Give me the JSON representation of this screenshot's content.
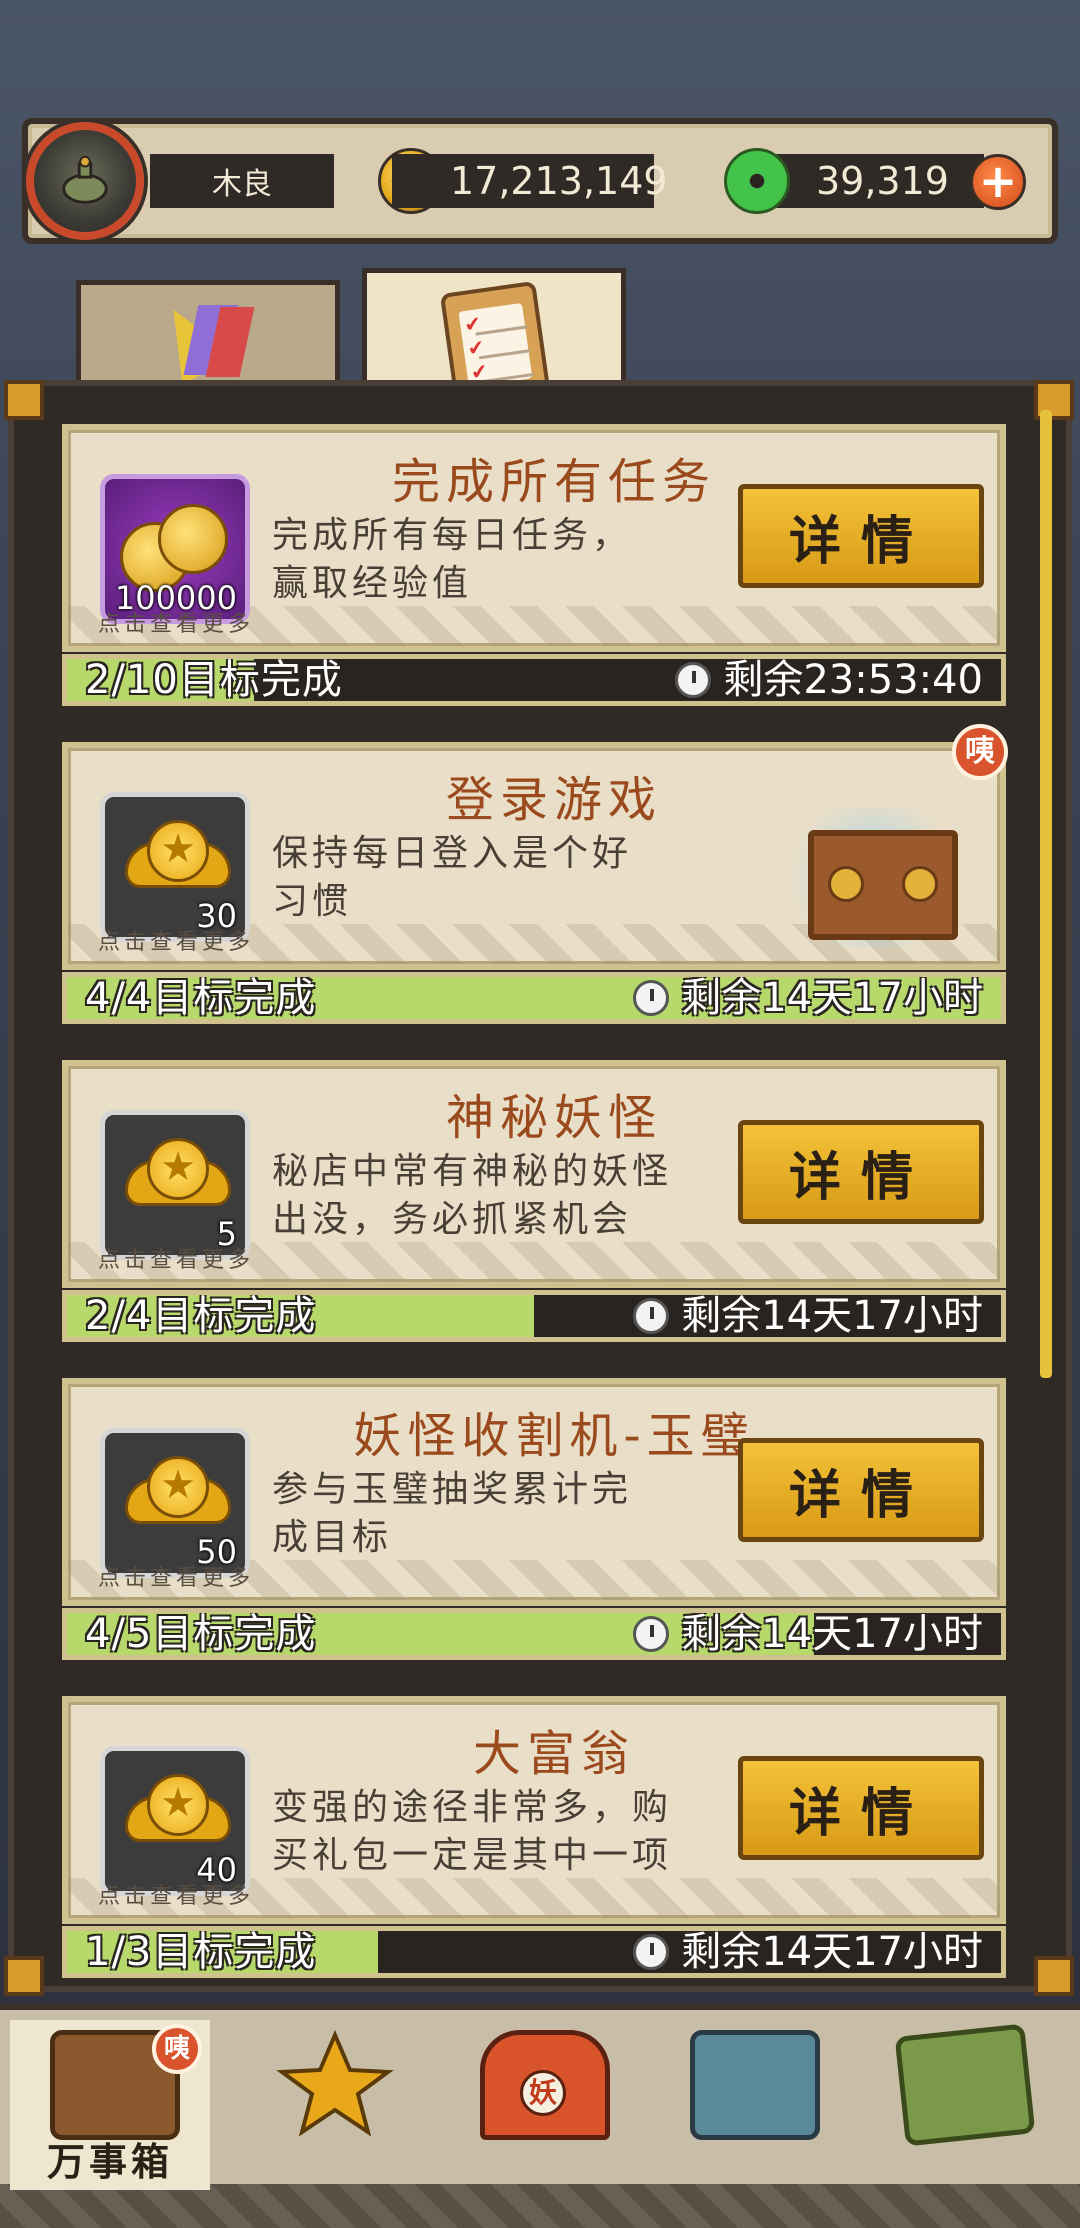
{
  "header": {
    "player_name": "木良",
    "coins": "17,213,149",
    "jade": "39,319",
    "plus_symbol": "+"
  },
  "tabs": [
    {
      "name": "flags",
      "active": false
    },
    {
      "name": "tasks",
      "active": true
    }
  ],
  "tasks": [
    {
      "title": "完成所有任务",
      "description": "完成所有每日任务，赢取经验值",
      "desc_line1": "完成所有每日任务，",
      "desc_line2": "赢取经验值",
      "reward_count": "100000",
      "reward_icon": "gold-coins-icon",
      "click_more": "点击查看更多",
      "button": "详情",
      "progress_text": "2/10目标完成",
      "progress_fraction": 0.2,
      "remaining": "剩余23:53:40"
    },
    {
      "title": "登录游戏",
      "desc_line1": "保持每日登入是个好",
      "desc_line2": "习惯",
      "reward_count": "30",
      "reward_icon": "medal-icon",
      "click_more": "点击查看更多",
      "badge": "咦",
      "progress_text": "4/4目标完成",
      "progress_fraction": 1.0,
      "remaining": "剩余14天17小时"
    },
    {
      "title": "神秘妖怪",
      "desc_line1": "秘店中常有神秘的妖怪",
      "desc_line2": "出没，务必抓紧机会",
      "reward_count": "5",
      "reward_icon": "medal-icon",
      "click_more": "点击查看更多",
      "button": "详情",
      "progress_text": "2/4目标完成",
      "progress_fraction": 0.5,
      "remaining": "剩余14天17小时"
    },
    {
      "title": "妖怪收割机-玉璧",
      "desc_line1": "参与玉璧抽奖累计完",
      "desc_line2": "成目标",
      "reward_count": "50",
      "reward_icon": "medal-icon",
      "click_more": "点击查看更多",
      "button": "详情",
      "progress_text": "4/5目标完成",
      "progress_fraction": 0.8,
      "remaining": "剩余14天17小时"
    },
    {
      "title": "大富翁",
      "desc_line1": "变强的途径非常多，购",
      "desc_line2": "买礼包一定是其中一项",
      "reward_count": "40",
      "reward_icon": "medal-icon",
      "click_more": "点击查看更多",
      "button": "详情",
      "progress_text": "1/3目标完成",
      "progress_fraction": 0.333,
      "remaining": "剩余14天17小时"
    }
  ],
  "bottom_nav": {
    "items": [
      {
        "label": "万事箱",
        "icon": "treasure-chest-icon",
        "active": true,
        "badge": "咦"
      },
      {
        "label": "",
        "icon": "star-trophy-icon",
        "active": false
      },
      {
        "label": "",
        "icon": "shrine-gate-icon",
        "active": false,
        "gate_text": "妖"
      },
      {
        "label": "",
        "icon": "market-stall-icon",
        "active": false
      },
      {
        "label": "",
        "icon": "treasure-map-icon",
        "active": false
      }
    ]
  },
  "colors": {
    "accent_gold": "#e3a716",
    "progress_green": "#b7d86a",
    "title_brown": "#9a4a1c",
    "badge_red": "#d9532c",
    "panel_dark": "#2f2a25"
  }
}
